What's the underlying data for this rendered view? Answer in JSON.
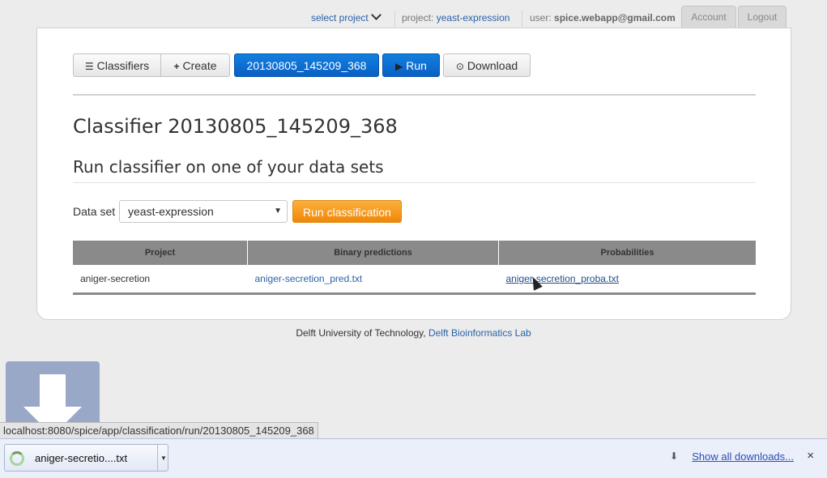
{
  "topnav": {
    "select_project": "select project",
    "project_label": "project:",
    "project_value": "yeast-expression",
    "user_label": "user:",
    "user_value": "spice.webapp@gmail.com",
    "account": "Account",
    "logout": "Logout"
  },
  "toolbar": {
    "classifiers": "Classifiers",
    "create": "Create",
    "classifier_id": "20130805_145209_368",
    "run": "Run",
    "download": "Download"
  },
  "page": {
    "title": "Classifier 20130805_145209_368",
    "subtitle": "Run classifier on one of your data sets",
    "dataset_label": "Data set",
    "dataset_selected": "yeast-expression",
    "run_classification": "Run classification"
  },
  "table": {
    "headers": [
      "Project",
      "Binary predictions",
      "Probabilities"
    ],
    "rows": [
      [
        "aniger-secretion",
        "aniger-secretion_pred.txt",
        "aniger-secretion_proba.txt"
      ]
    ]
  },
  "footer": {
    "text": "Delft University of Technology,",
    "link": "Delft Bioinformatics Lab"
  },
  "status_url": "localhost:8080/spice/app/classification/run/20130805_145209_368",
  "downloads": {
    "file": "aniger-secretio....txt",
    "show_all": "Show all downloads...",
    "close": "×"
  }
}
